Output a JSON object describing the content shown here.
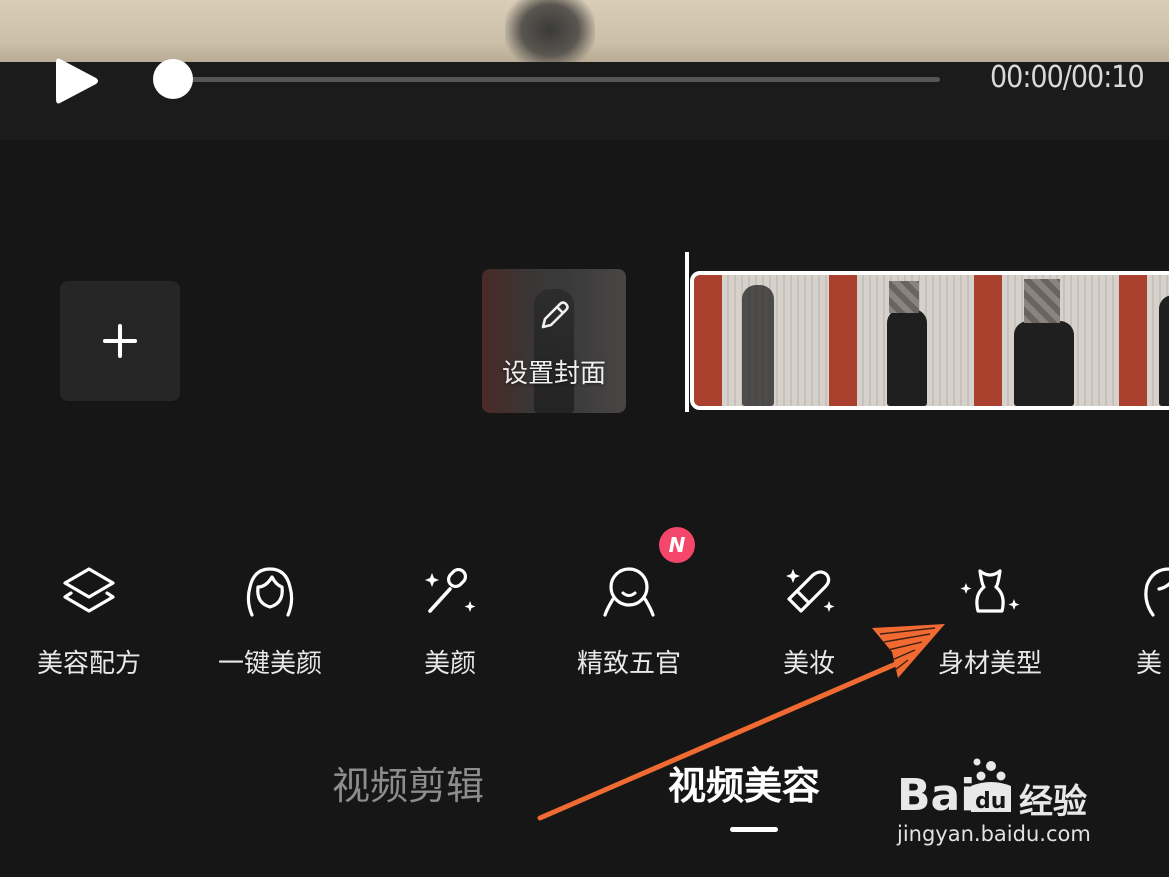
{
  "player": {
    "time": "00:00/00:10",
    "progress": 0
  },
  "timeline": {
    "cover_label": "设置封面"
  },
  "tools": [
    {
      "label": "美容配方",
      "icon": "layers-icon"
    },
    {
      "label": "一键美颜",
      "icon": "face-hair-icon"
    },
    {
      "label": "美颜",
      "icon": "brush-sparkle-icon"
    },
    {
      "label": "精致五官",
      "icon": "face-outline-icon",
      "badge": "N"
    },
    {
      "label": "美妆",
      "icon": "lipstick-icon"
    },
    {
      "label": "身材美型",
      "icon": "body-shape-icon"
    },
    {
      "label": "美",
      "icon": "hair-style-icon"
    }
  ],
  "tabs": [
    {
      "label": "视频剪辑",
      "active": false
    },
    {
      "label": "视频美容",
      "active": true
    }
  ],
  "watermark": {
    "url": "jingyan.baidu.com",
    "text": "经验"
  },
  "colors": {
    "background": "#161616",
    "badge": "#f5476b",
    "arrow": "#f06a32"
  }
}
